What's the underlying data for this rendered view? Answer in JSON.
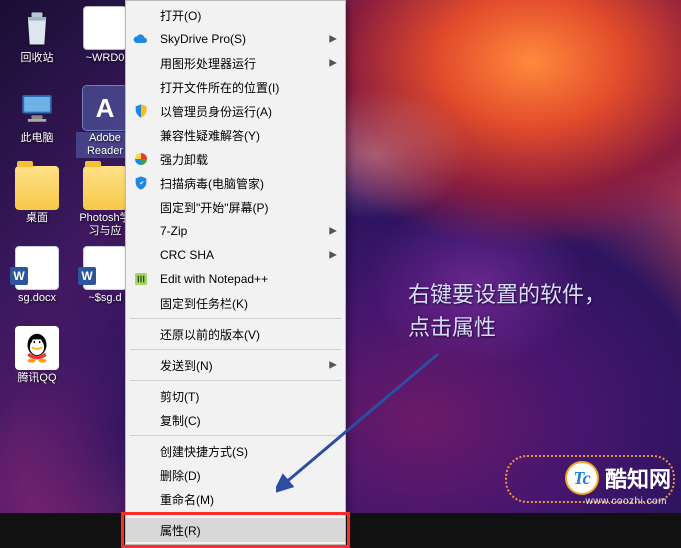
{
  "desktop": {
    "icons": [
      {
        "id": "recycle-bin",
        "label": "回收站",
        "glyph": "recycle"
      },
      {
        "id": "wrd0",
        "label": "~WRD0",
        "glyph": "doc"
      },
      {
        "id": "this-pc",
        "label": "此电脑",
        "glyph": "thispc"
      },
      {
        "id": "adobe-reader",
        "label": "Adobe Reader",
        "glyph": "adobe",
        "selected": true
      },
      {
        "id": "desktop-fld",
        "label": "桌面",
        "glyph": "folder"
      },
      {
        "id": "ps-tutorial",
        "label": "Photosh学习与应",
        "glyph": "folder"
      },
      {
        "id": "sg-docx",
        "label": "sg.docx",
        "glyph": "worddoc"
      },
      {
        "id": "sg-docx-tmp",
        "label": "~$sg.d",
        "glyph": "worddoc"
      },
      {
        "id": "qq",
        "label": "腾讯QQ",
        "glyph": "qq"
      }
    ]
  },
  "context_menu": {
    "items": [
      {
        "label": "打开(O)"
      },
      {
        "label": "SkyDrive Pro(S)",
        "submenu": true,
        "icon": "cloud"
      },
      {
        "label": "用图形处理器运行",
        "submenu": true
      },
      {
        "label": "打开文件所在的位置(I)"
      },
      {
        "label": "以管理员身份运行(A)",
        "icon": "shield"
      },
      {
        "label": "兼容性疑难解答(Y)"
      },
      {
        "label": "强力卸载",
        "icon": "colorwheel"
      },
      {
        "label": "扫描病毒(电脑管家)",
        "icon": "guard"
      },
      {
        "label": "固定到\"开始\"屏幕(P)"
      },
      {
        "label": "7-Zip",
        "submenu": true
      },
      {
        "label": "CRC SHA",
        "submenu": true
      },
      {
        "label": "Edit with Notepad++",
        "icon": "npp"
      },
      {
        "label": "固定到任务栏(K)"
      },
      {
        "sep": true
      },
      {
        "label": "还原以前的版本(V)"
      },
      {
        "sep": true
      },
      {
        "label": "发送到(N)",
        "submenu": true
      },
      {
        "sep": true
      },
      {
        "label": "剪切(T)"
      },
      {
        "label": "复制(C)"
      },
      {
        "sep": true
      },
      {
        "label": "创建快捷方式(S)"
      },
      {
        "label": "删除(D)"
      },
      {
        "label": "重命名(M)"
      },
      {
        "sep": true
      },
      {
        "label": "属性(R)",
        "hover": true
      }
    ]
  },
  "annotation": {
    "line1": "右键要设置的软件，",
    "line2": "点击属性"
  },
  "watermark": {
    "brand": "酷知网",
    "logo_text": "Tc",
    "url": "www.coozhi.com"
  }
}
